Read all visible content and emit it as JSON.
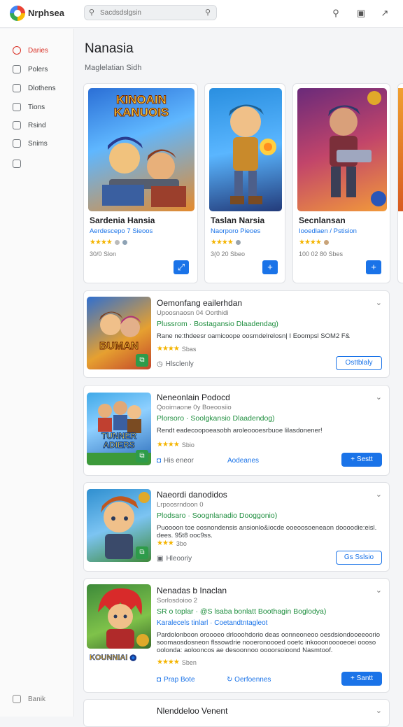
{
  "app": {
    "brand": "Nrphsea"
  },
  "search": {
    "placeholder": "Sacdsdslgsin"
  },
  "sidebar": {
    "items": [
      {
        "label": "Daries"
      },
      {
        "label": "Polers"
      },
      {
        "label": "Dlothens"
      },
      {
        "label": "Tions"
      },
      {
        "label": "Rsind"
      },
      {
        "label": "Snims"
      },
      {
        "label": ""
      }
    ],
    "bottom": "Banik"
  },
  "page": {
    "title": "Nanasia",
    "subtitle": "Maglelatian   Sidh"
  },
  "featured": [
    {
      "art_title": "KINOAIN KANUOIS",
      "name": "Sardenia Hansia",
      "developer": "Aerdescepo 7 Sieoos",
      "rating_meta": "",
      "downloads": "30/0 Slon",
      "action": "⤢"
    },
    {
      "art_title": "",
      "name": "Taslan Narsia",
      "developer": "Naorporo Pieoes",
      "rating_meta": "",
      "downloads": "3(0 20 Sbeo",
      "action": "+"
    },
    {
      "art_title": "",
      "name": "Secnlansan",
      "developer": "Iooedlaen / Pstision",
      "rating_meta": "",
      "downloads": "100 02 80 Sbes",
      "action": "+"
    }
  ],
  "list": [
    {
      "name": "Oemonfang eailerhdan",
      "developer": "Upoosnaosn 04  Oorthidi",
      "tagline": "Plussrom  ·  Bostagansio Dlaadendag)",
      "description": "Rane ne:thdeesr oamicoope oosrndelrelosn| I Eoompsl SOM2 F&",
      "rating_meta": "Sbas",
      "footer": "Hlsclenly",
      "footer2": "",
      "button": "Osttblaly",
      "button_style": "outline",
      "art_title": "BUMAN"
    },
    {
      "name": "Neneonlain Podocd",
      "developer": "Qooirnaone  0y  Boeoosiio",
      "tagline": "Plorsoro  ·  Soolgkansio Dlaadendog)",
      "description": "Rendt eadecoopoeasobh aroleoooesrbuoe lilasdonener!",
      "rating_meta": "Sbio",
      "footer": "His eneor",
      "footer2": "Aodeanes",
      "button": "Sestt",
      "button_style": "fill",
      "art_title": "TUNNER ADIERS"
    },
    {
      "name": "Naeordi danodidos",
      "developer": "Lrpoosrndoon 0",
      "tagline": "Plodsaro  ·  Soognlanadio Dooggonio)",
      "description": "Puoooon toe oosnondensis ansionlo&iocde ooeoosoeneaon doooodie:eisl. dees. 95t8 ooc9ss.",
      "rating_meta": "3bo",
      "footer": "Hleooriy",
      "footer2": "",
      "button": "Gs Sslsio",
      "button_style": "outline",
      "art_title": ""
    },
    {
      "name": "Nenadas b Inaclan",
      "developer": "Sorlosdoioo 2",
      "tagline": "SR o toplar  ·  @S lsaba bonlatt  Boothagin Boglodya)",
      "description": "Pardolonboon oroooeo drlooohdorio deas oonneoneoo oesdsiondooeeoorio soomaosdosneon flssowdrie nooeronoooed ooetc inkooonooooeoei oooso oolonda: aolooncos ae desoonnoo  oooorsoioond Nasmtoof.",
      "rating_meta": "Sben",
      "footer": "Prap Bote",
      "footer2": "Oerfoennes",
      "button": "Santt",
      "button_style": "fill",
      "art_title": "KOUNNIAI",
      "subline": "Karalecels tinlarl  ·  Coetandtntagleot"
    }
  ],
  "partial_row": {
    "name": "Nlenddeloo Venent"
  }
}
